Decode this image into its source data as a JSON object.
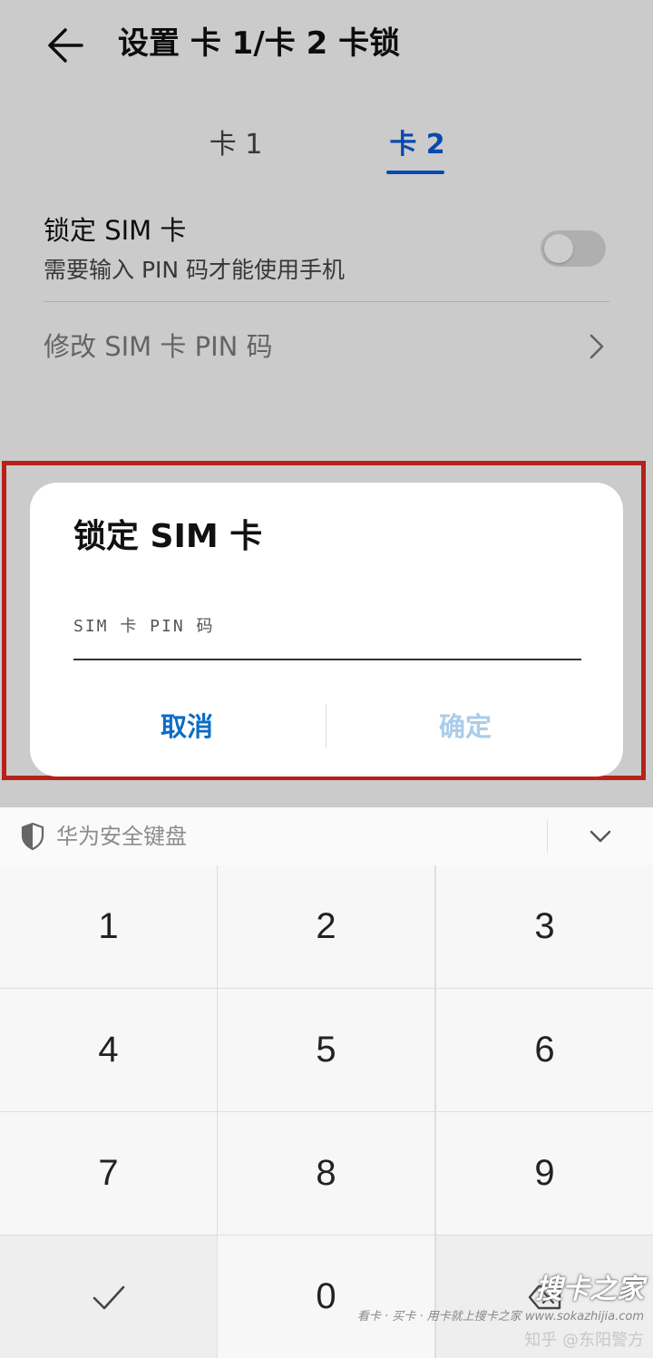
{
  "header": {
    "title": "设置 卡 1/卡 2 卡锁"
  },
  "tabs": [
    {
      "label": "卡 1",
      "selected": false
    },
    {
      "label": "卡 2",
      "selected": true
    }
  ],
  "settings": {
    "lock_sim": {
      "title": "锁定 SIM 卡",
      "subtitle": "需要输入 PIN 码才能使用手机",
      "enabled": false
    },
    "change_pin": {
      "label": "修改 SIM 卡 PIN 码"
    }
  },
  "dialog": {
    "title": "锁定 SIM 卡",
    "input_placeholder": "SIM 卡 PIN 码",
    "cancel_label": "取消",
    "confirm_label": "确定"
  },
  "keyboard": {
    "title": "华为安全键盘",
    "keys": [
      "1",
      "2",
      "3",
      "4",
      "5",
      "6",
      "7",
      "8",
      "9",
      "0"
    ]
  },
  "watermark": {
    "brand": "搜卡之家",
    "url": "看卡 · 买卡 · 用卡就上搜卡之家 www.sokazhijia.com",
    "credit": "知乎 @东阳警方"
  },
  "colors": {
    "accent": "#0a59d6",
    "cancel": "#0b6dc5",
    "confirm_disabled": "#a9cdea",
    "highlight": "#b8211a"
  },
  "icons": {
    "back": "arrow-left-icon",
    "chevron": "chevron-right-icon",
    "shield": "shield-icon",
    "collapse": "chevron-down-icon",
    "done": "check-icon",
    "delete": "backspace-icon"
  }
}
